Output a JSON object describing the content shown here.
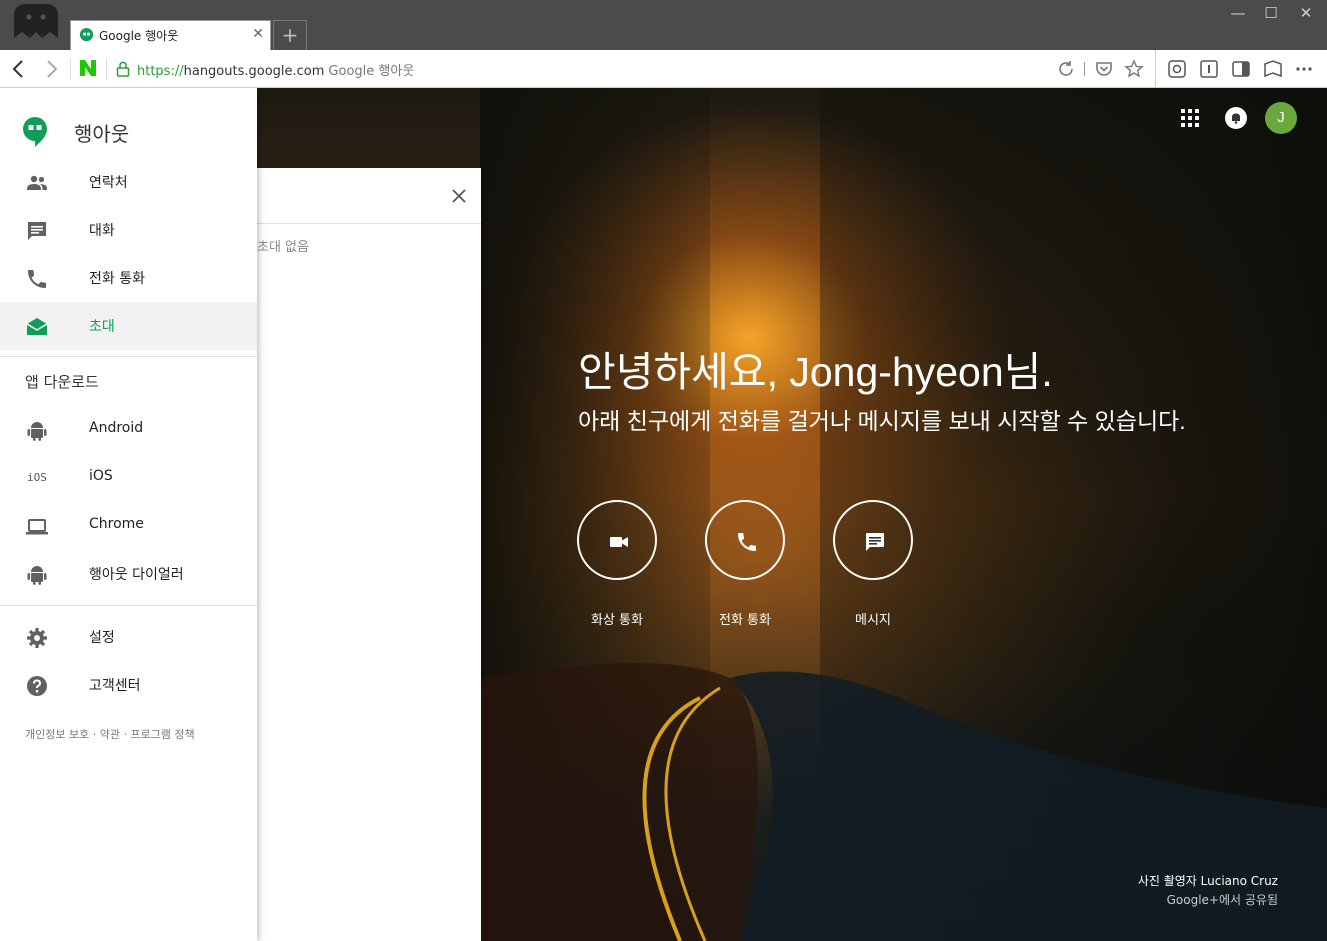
{
  "browser": {
    "tab_title": "Google 행아웃",
    "url_scheme": "https://",
    "url_host": "hangouts.google.com",
    "page_title": "Google 행아웃"
  },
  "drawer": {
    "brand": "행아웃",
    "items": [
      {
        "label": "연락처",
        "icon": "contacts-icon"
      },
      {
        "label": "대화",
        "icon": "chat-icon"
      },
      {
        "label": "전화 통화",
        "icon": "phone-icon"
      },
      {
        "label": "초대",
        "icon": "invite-mail-icon"
      }
    ],
    "download_section": "앱 다운로드",
    "downloads": [
      {
        "label": "Android",
        "icon": "android-icon"
      },
      {
        "label": "iOS",
        "icon": "ios-icon"
      },
      {
        "label": "Chrome",
        "icon": "laptop-icon"
      },
      {
        "label": "행아웃 다이얼러",
        "icon": "android-icon"
      }
    ],
    "settings": [
      {
        "label": "설정",
        "icon": "gear-icon"
      },
      {
        "label": "고객센터",
        "icon": "help-icon"
      }
    ],
    "ios_glyph": "iOS",
    "footer": "개인정보 보호 · 약관 · 프로그램 정책"
  },
  "invites_panel": {
    "empty_text": "초대 없음"
  },
  "main": {
    "greeting": "안녕하세요, Jong-hyeon님.",
    "subtitle": "아래 친구에게 전화를 걸거나 메시지를 보내 시작할 수 있습니다.",
    "actions": [
      {
        "label": "화상 통화",
        "icon": "video-camera-icon"
      },
      {
        "label": "전화 통화",
        "icon": "phone-icon"
      },
      {
        "label": "메시지",
        "icon": "message-icon"
      }
    ],
    "avatar_initial": "J",
    "photo_credit": "사진 촬영자 Luciano Cruz",
    "photo_source": "Google+에서 공유됨"
  },
  "colors": {
    "accent": "#0f9d58",
    "avatar": "#6aa73c",
    "titlebar": "#4b4b4b"
  }
}
